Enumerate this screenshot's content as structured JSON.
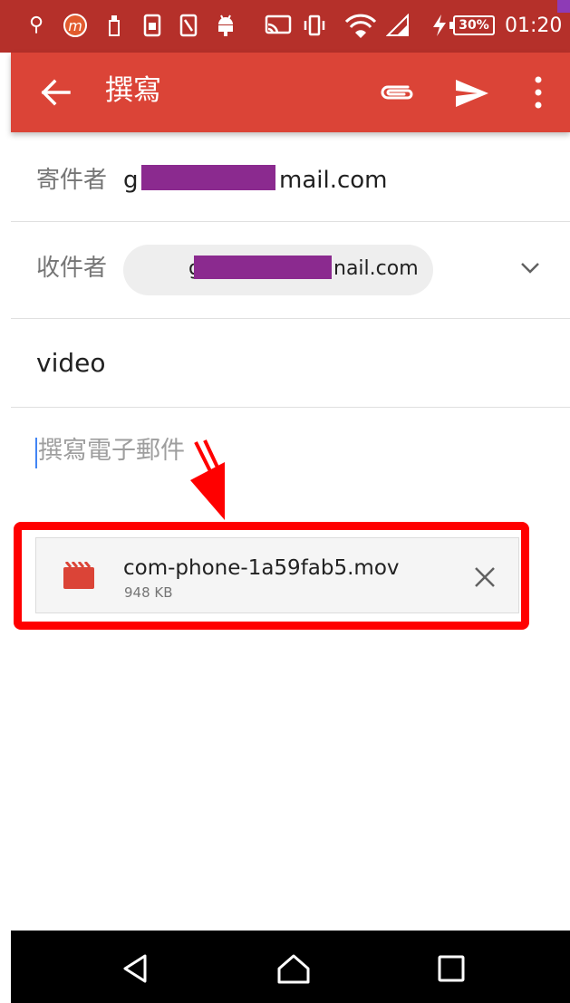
{
  "status_bar": {
    "battery": "30%",
    "time": "01:20",
    "icons": [
      "usb-icon",
      "m-app-icon",
      "usb-storage-icon",
      "sim-icon",
      "nfc-icon",
      "android-icon",
      "cast-icon",
      "vibrate-icon",
      "wifi-icon",
      "signal-icon",
      "charging-icon"
    ]
  },
  "app_bar": {
    "title": "撰寫",
    "icons": [
      "back-arrow-icon",
      "paperclip-icon",
      "send-icon",
      "more-vert-icon"
    ]
  },
  "compose": {
    "from_label": "寄件者",
    "from_prefix": "g",
    "from_suffix": "mail.com",
    "to_label": "收件者",
    "to_prefix": "g",
    "to_suffix": "nail.com",
    "subject": "video",
    "body_placeholder": "撰寫電子郵件"
  },
  "attachment": {
    "name": "com-phone-1a59fab5.mov",
    "size": "948 KB",
    "icon": "movie-clapper-icon"
  },
  "colors": {
    "status_bar": "#b5302a",
    "app_bar": "#db4437",
    "highlight": "#ff0000",
    "redaction": "#8b2a8f"
  }
}
